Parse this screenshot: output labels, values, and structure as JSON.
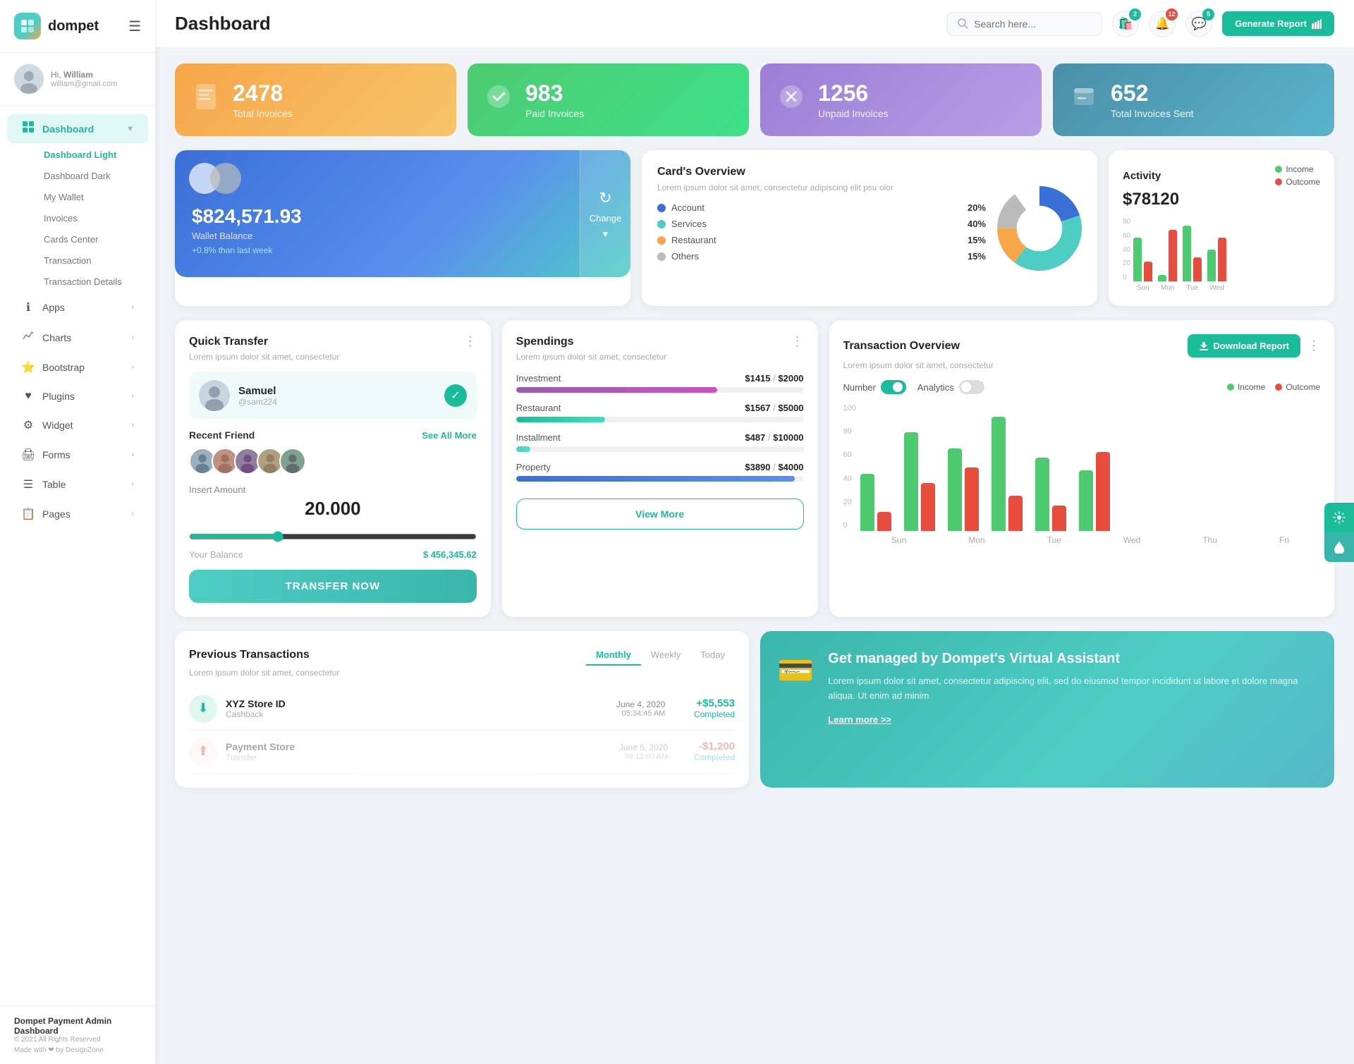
{
  "app": {
    "name": "dompet",
    "logo_emoji": "👛"
  },
  "topbar": {
    "title": "Dashboard",
    "search_placeholder": "Search here...",
    "search_icon": "🔍",
    "notifications_count": "2",
    "bell_count": "12",
    "chat_count": "5",
    "generate_btn": "Generate Report"
  },
  "sidebar": {
    "user": {
      "greeting": "Hi,",
      "name": "William",
      "email": "william@gmail.com"
    },
    "nav": [
      {
        "id": "dashboard",
        "label": "Dashboard",
        "icon": "⊞",
        "active": true,
        "expandable": true
      },
      {
        "id": "dashboard-light",
        "label": "Dashboard Light",
        "sub": true,
        "active": true
      },
      {
        "id": "dashboard-dark",
        "label": "Dashboard Dark",
        "sub": true
      },
      {
        "id": "my-wallet",
        "label": "My Wallet",
        "sub": true
      },
      {
        "id": "invoices",
        "label": "Invoices",
        "sub": true
      },
      {
        "id": "cards-center",
        "label": "Cards Center",
        "sub": true
      },
      {
        "id": "transaction",
        "label": "Transaction",
        "sub": true
      },
      {
        "id": "transaction-details",
        "label": "Transaction Details",
        "sub": true
      },
      {
        "id": "apps",
        "label": "Apps",
        "icon": "ℹ️",
        "expandable": true
      },
      {
        "id": "charts",
        "label": "Charts",
        "icon": "📈",
        "expandable": true
      },
      {
        "id": "bootstrap",
        "label": "Bootstrap",
        "icon": "⭐",
        "expandable": true
      },
      {
        "id": "plugins",
        "label": "Plugins",
        "icon": "❤️",
        "expandable": true
      },
      {
        "id": "widget",
        "label": "Widget",
        "icon": "⚙️",
        "expandable": true
      },
      {
        "id": "forms",
        "label": "Forms",
        "icon": "🖨️",
        "expandable": true
      },
      {
        "id": "table",
        "label": "Table",
        "icon": "☰",
        "expandable": true
      },
      {
        "id": "pages",
        "label": "Pages",
        "icon": "📋",
        "expandable": true
      }
    ],
    "footer": {
      "title": "Dompet Payment Admin Dashboard",
      "copy": "© 2021 All Rights Reserved",
      "made": "Made with ❤ by DesignZone"
    }
  },
  "stat_cards": [
    {
      "id": "total-invoices",
      "num": "2478",
      "label": "Total Invoices",
      "color": "orange",
      "icon": "📋"
    },
    {
      "id": "paid-invoices",
      "num": "983",
      "label": "Paid Invoices",
      "color": "green",
      "icon": "✅"
    },
    {
      "id": "unpaid-invoices",
      "num": "1256",
      "label": "Unpaid Invoices",
      "color": "purple",
      "icon": "❌"
    },
    {
      "id": "total-sent",
      "num": "652",
      "label": "Total Invoices Sent",
      "color": "teal",
      "icon": "📊"
    }
  ],
  "wallet": {
    "balance": "$824,571.93",
    "label": "Wallet Balance",
    "change": "+0.8% than last week",
    "change_btn": "Change"
  },
  "card_overview": {
    "title": "Card's Overview",
    "subtitle": "Lorem ipsum dolor sit amet, consectetur adipiscing elit psu olor",
    "items": [
      {
        "label": "Account",
        "pct": "20%",
        "color": "#3a6fd8"
      },
      {
        "label": "Services",
        "pct": "40%",
        "color": "#4ecdc4"
      },
      {
        "label": "Restaurant",
        "pct": "15%",
        "color": "#f7a64a"
      },
      {
        "label": "Others",
        "pct": "15%",
        "color": "#bbb"
      }
    ],
    "donut": {
      "segments": [
        {
          "pct": 20,
          "color": "#3a6fd8"
        },
        {
          "pct": 40,
          "color": "#4ecdc4"
        },
        {
          "pct": 15,
          "color": "#f7a64a"
        },
        {
          "pct": 15,
          "color": "#ccc"
        }
      ]
    }
  },
  "activity": {
    "title": "Activity",
    "amount": "$78120",
    "legend": [
      {
        "label": "Income",
        "color": "#4ecb71"
      },
      {
        "label": "Outcome",
        "color": "#e74c3c"
      }
    ],
    "bars": [
      {
        "day": "Sun",
        "income": 55,
        "outcome": 25
      },
      {
        "day": "Mon",
        "income": 8,
        "outcome": 65
      },
      {
        "day": "Tue",
        "income": 70,
        "outcome": 30
      },
      {
        "day": "Wed",
        "income": 40,
        "outcome": 55
      }
    ],
    "y_labels": [
      "80",
      "60",
      "40",
      "20",
      "0"
    ]
  },
  "quick_transfer": {
    "title": "Quick Transfer",
    "subtitle": "Lorem ipsum dolor sit amet, consectetur",
    "user": {
      "name": "Samuel",
      "handle": "@sam224"
    },
    "recent_friends_label": "Recent Friend",
    "see_all": "See All More",
    "insert_amount_label": "Insert Amount",
    "amount": "20.000",
    "balance_label": "Your Balance",
    "balance": "$ 456,345.62",
    "transfer_btn": "TRANSFER NOW"
  },
  "spendings": {
    "title": "Spendings",
    "subtitle": "Lorem ipsum dolor sit amet, consectetur",
    "items": [
      {
        "name": "Investment",
        "value": "$1415",
        "max": "$2000",
        "pct": 70,
        "color": "#b04ecb"
      },
      {
        "name": "Restaurant",
        "value": "$1567",
        "max": "$5000",
        "pct": 31,
        "color": "#1abc9c"
      },
      {
        "name": "Installment",
        "value": "$487",
        "max": "$10000",
        "pct": 5,
        "color": "#4ecdc4"
      },
      {
        "name": "Property",
        "value": "$3890",
        "max": "$4000",
        "pct": 97,
        "color": "#3a6fd8"
      }
    ],
    "view_btn": "View More"
  },
  "transaction_overview": {
    "title": "Transaction Overview",
    "subtitle": "Lorem ipsum dolor sit amet, consectetur",
    "download_btn": "Download Report",
    "toggle_number": "Number",
    "toggle_number_on": true,
    "toggle_analytics": "Analytics",
    "toggle_analytics_on": false,
    "legend": [
      {
        "label": "Income",
        "color": "#4ecb71"
      },
      {
        "label": "Outcome",
        "color": "#e74c3c"
      }
    ],
    "bars": [
      {
        "day": "Sun",
        "income": 45,
        "outcome": 15
      },
      {
        "day": "Mon",
        "income": 78,
        "outcome": 38
      },
      {
        "day": "Tue",
        "income": 65,
        "outcome": 50
      },
      {
        "day": "Wed",
        "income": 90,
        "outcome": 28
      },
      {
        "day": "Thu",
        "income": 58,
        "outcome": 20
      },
      {
        "day": "Fri",
        "income": 48,
        "outcome": 62
      }
    ],
    "y_labels": [
      "100",
      "80",
      "60",
      "40",
      "20",
      "0"
    ]
  },
  "prev_transactions": {
    "title": "Previous Transactions",
    "subtitle": "Lorem ipsum dolor sit amet, consectetur",
    "tabs": [
      "Monthly",
      "Weekly",
      "Today"
    ],
    "active_tab": "Monthly",
    "rows": [
      {
        "icon": "⬇️",
        "name": "XYZ Store ID",
        "type": "Cashback",
        "date": "June 4, 2020",
        "time": "05:34:45 AM",
        "amount": "+$5,553",
        "status": "Completed"
      }
    ]
  },
  "virtual_assistant": {
    "title": "Get managed by Dompet's Virtual Assistant",
    "desc": "Lorem ipsum dolor sit amet, consectetur adipiscing elit, sed do eiusmod tempor incididunt ut labore et dolore magna aliqua. Ut enim ad minim",
    "link": "Learn more >>",
    "icon": "💳"
  }
}
